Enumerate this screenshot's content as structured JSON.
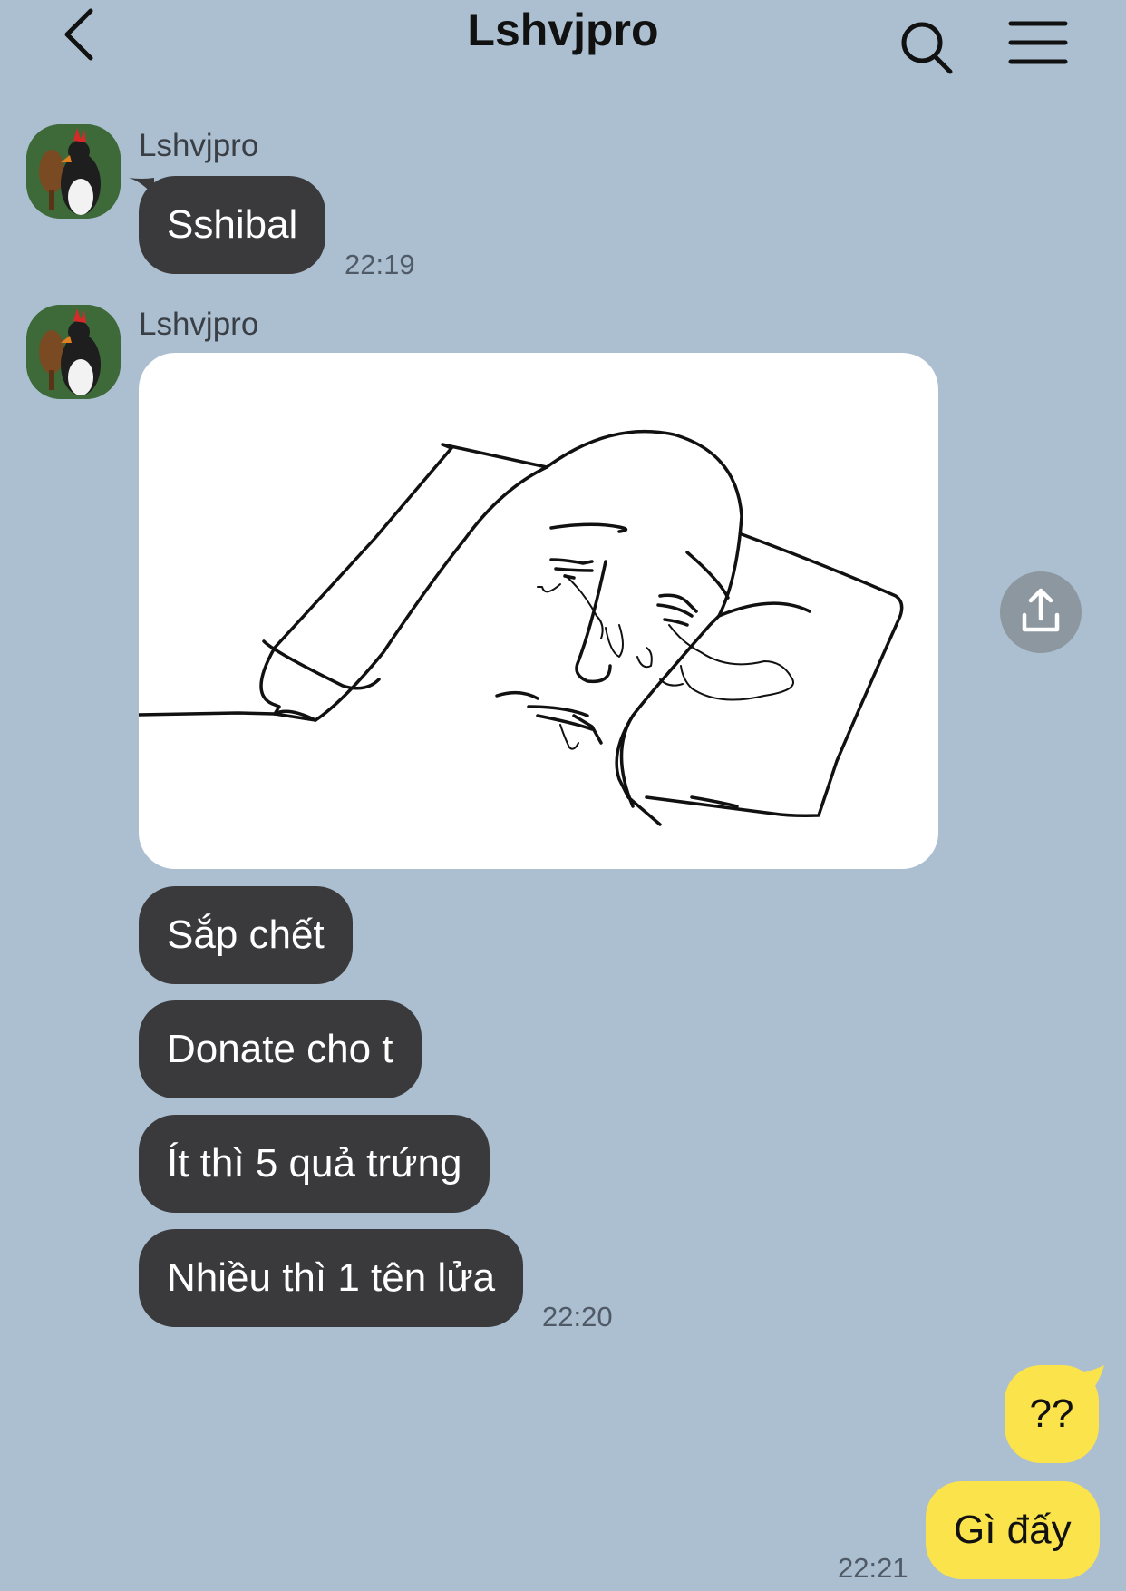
{
  "header": {
    "title": "Lshvjpro",
    "back_icon": "chevron-left-icon",
    "search_icon": "search-icon",
    "menu_icon": "hamburger-menu-icon"
  },
  "colors": {
    "background": "#abbfd1",
    "incoming_bubble": "#3a3a3c",
    "outgoing_bubble": "#fae34b"
  },
  "messages": {
    "group1": {
      "sender": "Lshvjpro",
      "bubbles": [
        "Sshibal"
      ],
      "time": "22:19"
    },
    "group2": {
      "sender": "Lshvjpro",
      "image": "crying-face-on-pillow-drawing",
      "share_icon": "share-upload-icon",
      "bubbles": [
        "Sắp chết",
        "Donate cho t",
        "Ít thì 5 quả trứng",
        "Nhiều thì 1 tên lửa"
      ],
      "time": "22:20"
    },
    "mine": {
      "bubbles": [
        "??",
        "Gì đấy"
      ],
      "time": "22:21"
    }
  }
}
